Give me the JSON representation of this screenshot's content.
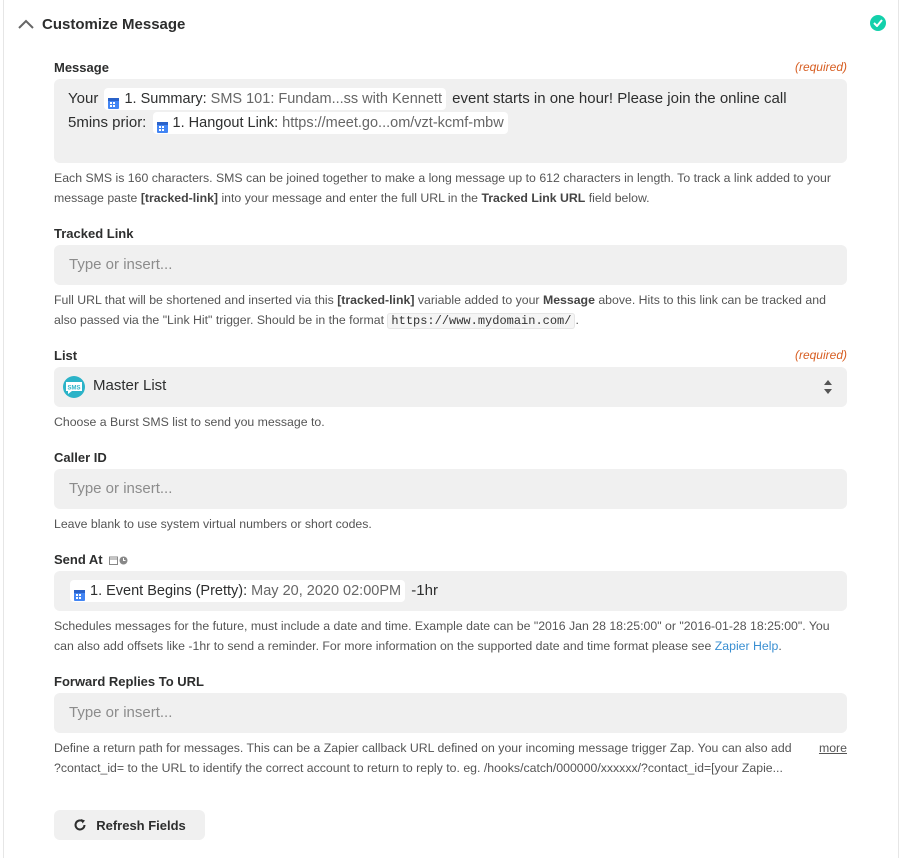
{
  "section": {
    "title": "Customize Message"
  },
  "message": {
    "label": "Message",
    "required": "(required)",
    "segments": {
      "t1": "Your",
      "pill1_key": "1. Summary:",
      "pill1_val": "SMS 101: Fundam...ss with Kennett",
      "t2": "event starts in one hour! Please join the online call",
      "t3": "5mins prior:",
      "pill2_key": "1. Hangout Link:",
      "pill2_val": "https://meet.go...om/vzt-kcmf-mbw"
    },
    "help": {
      "p1": "Each SMS is 160 characters. SMS can be joined together to make a long message up to 612 characters in length. To track a link added to your message paste ",
      "b1": "[tracked-link]",
      "p2": " into your message and enter the full URL in the ",
      "b2": "Tracked Link URL",
      "p3": " field below."
    }
  },
  "tracked_link": {
    "label": "Tracked Link",
    "placeholder": "Type or insert...",
    "help": {
      "p1": "Full URL that will be shortened and inserted via this ",
      "b1": "[tracked-link]",
      "p2": " variable added to your ",
      "b2": "Message",
      "p3": " above. Hits to this link can be tracked and also passed via the \"Link Hit\" trigger. Should be in the format ",
      "code": "https://www.mydomain.com/",
      "p4": "."
    }
  },
  "list": {
    "label": "List",
    "required": "(required)",
    "icon_text": "SMS",
    "value": "Master List",
    "help": "Choose a Burst SMS list to send you message to."
  },
  "caller_id": {
    "label": "Caller ID",
    "placeholder": "Type or insert...",
    "help": "Leave blank to use system virtual numbers or short codes."
  },
  "send_at": {
    "label": "Send At",
    "pill_key": "1. Event Begins (Pretty):",
    "pill_val": "May 20, 2020 02:00PM",
    "suffix": "-1hr",
    "help_p1": "Schedules messages for the future, must include a date and time. Example date can be \"2016 Jan 28 18:25:00\" or \"2016-01-28 18:25:00\". You can also add offsets like -1hr to send a reminder. For more information on the supported date and time format please see ",
    "help_link": "Zapier Help",
    "help_p2": "."
  },
  "forward": {
    "label": "Forward Replies To URL",
    "placeholder": "Type or insert...",
    "help_line1": "Define a return path for messages. This can be a Zapier callback URL defined on your incoming message trigger Zap. You can also add",
    "help_line2": "?contact_id= to the URL to identify the correct account to return to reply to. eg. /hooks/catch/000000/xxxxxx/?contact_id=[your Zapie...",
    "more": "more"
  },
  "refresh": {
    "label": "Refresh Fields"
  },
  "colors": {
    "accent_green": "#13d0ab",
    "required": "#d75e22",
    "link": "#3a8fd2",
    "field_bg": "#f0f0f0"
  }
}
